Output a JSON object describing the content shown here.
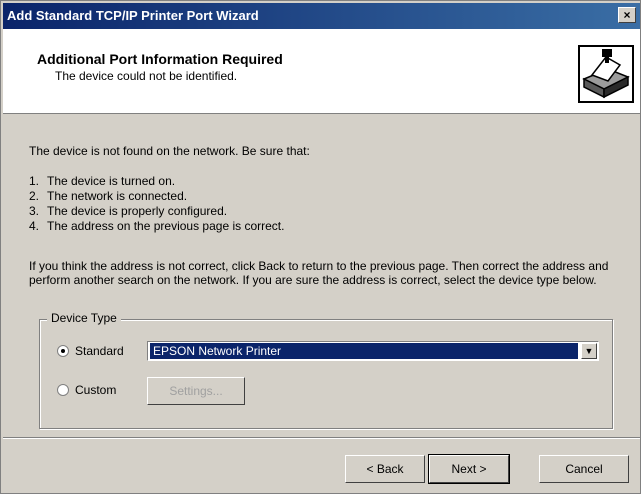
{
  "window": {
    "title": "Add Standard TCP/IP Printer Port Wizard",
    "close_label": "×"
  },
  "header": {
    "title": "Additional Port Information Required",
    "subtitle": "The device could not be identified.",
    "icon": "printer-network-icon"
  },
  "body": {
    "intro": "The device is not found on the network. Be sure that:",
    "list": [
      {
        "num": "1.",
        "text": "The device is turned on."
      },
      {
        "num": "2.",
        "text": "The network is connected."
      },
      {
        "num": "3.",
        "text": "The device is properly configured."
      },
      {
        "num": "4.",
        "text": "The address on the previous page is correct."
      }
    ],
    "paragraph": "If you think the address is not correct, click Back to return to the previous page. Then correct the address and perform another search on the network. If you are sure the address is correct, select the device type below."
  },
  "device_type": {
    "legend": "Device Type",
    "standard_label": "Standard",
    "standard_selected": true,
    "dropdown_value": "EPSON Network Printer",
    "custom_label": "Custom",
    "custom_selected": false,
    "settings_label": "Settings..."
  },
  "footer": {
    "back_label": "< Back",
    "next_label": "Next >",
    "cancel_label": "Cancel"
  },
  "colors": {
    "titlebar": "#0a246a",
    "face": "#d4d0c8",
    "selection": "#0a246a"
  }
}
